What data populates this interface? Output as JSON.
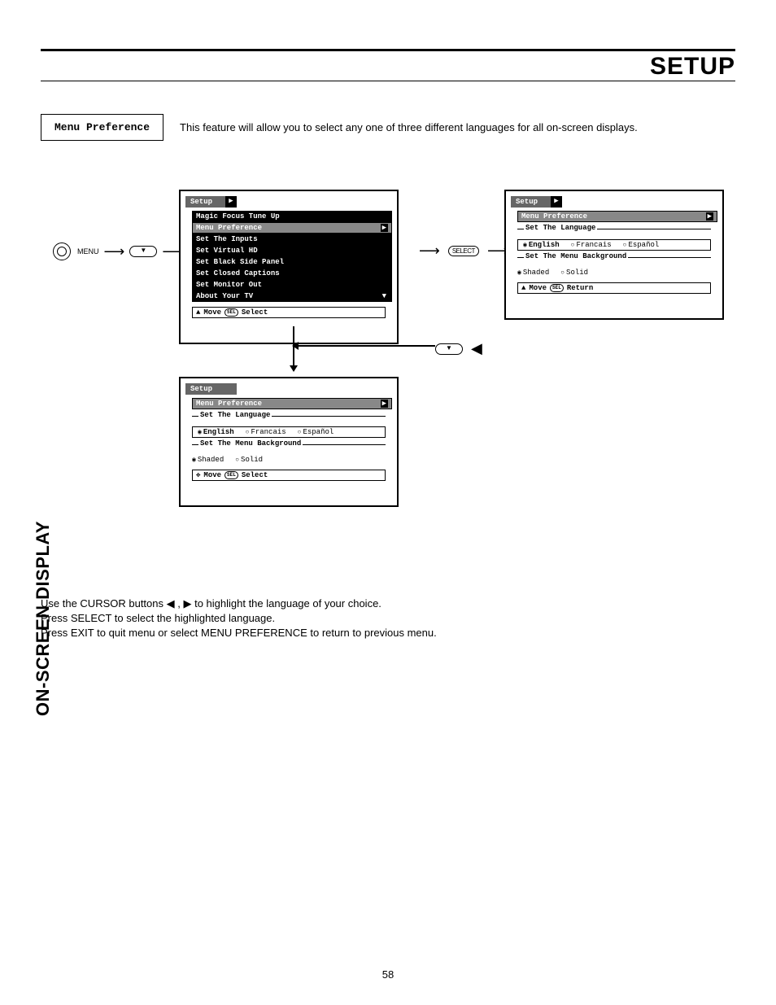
{
  "page": {
    "title": "SETUP",
    "side_tab": "ON-SCREEN DISPLAY",
    "number": "58"
  },
  "intro": {
    "box_label": "Menu Preference",
    "text": "This feature will allow you to select any one of three different languages for all on-screen displays."
  },
  "remote": {
    "menu": "MENU",
    "select": "SELECT"
  },
  "osd_main": {
    "title": "Setup",
    "items": [
      "Magic Focus Tune Up",
      "Menu Preference",
      "Set The Inputs",
      "Set Virtual HD",
      "Set Black Side Panel",
      "Set Closed Captions",
      "Set Monitor Out",
      "About Your TV"
    ],
    "foot_move": "Move",
    "foot_action": "Select"
  },
  "osd_pref": {
    "title": "Setup",
    "sub": "Menu Preference",
    "lang_legend": "Set The Language",
    "langs": {
      "en": "English",
      "fr": "Francais",
      "es": "Español"
    },
    "bg_legend": "Set The Menu Background",
    "bg": {
      "shaded": "Shaded",
      "solid": "Solid"
    },
    "foot_move": "Move",
    "foot_select": "Select",
    "foot_return": "Return"
  },
  "instructions": {
    "l1a": "Use the CURSOR buttons ",
    "l1b": " to highlight the language of your choice.",
    "l2": "Press SELECT to select the highlighted language.",
    "l3": "Press EXIT to quit menu or select MENU PREFERENCE to return to previous menu."
  },
  "glyphs": {
    "left": "◀",
    "right": "▶",
    "sep": " , ",
    "updown": "▲▼",
    "allarrow": "✥",
    "rchev": "▶",
    "dchev": "▼",
    "sel": "SEL"
  }
}
